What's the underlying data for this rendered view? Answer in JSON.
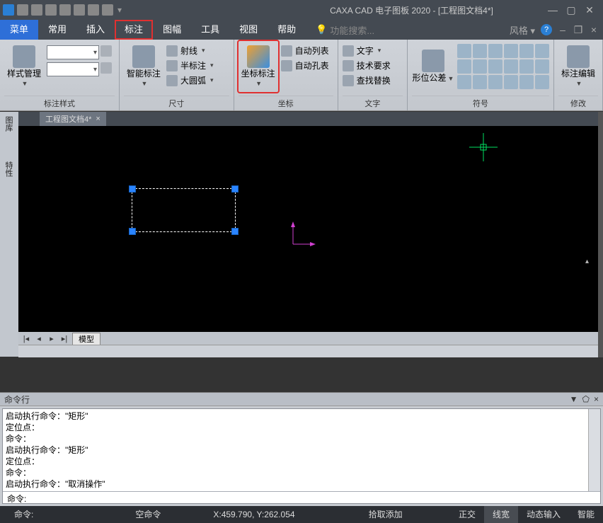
{
  "title": "CAXA CAD 电子图板 2020 - [工程图文档4*]",
  "menubar": {
    "items": [
      "菜单",
      "常用",
      "插入",
      "标注",
      "图幅",
      "工具",
      "视图",
      "帮助"
    ],
    "search_placeholder": "功能搜索...",
    "style_label": "风格"
  },
  "ribbon": {
    "g1": {
      "label": "标注样式",
      "big": "样式管理"
    },
    "g2": {
      "label": "尺寸",
      "big": "智能标注",
      "rows": [
        "射线",
        "半标注",
        "大圆弧"
      ]
    },
    "g3": {
      "label": "坐标",
      "big": "坐标标注",
      "rows": [
        "自动列表",
        "自动孔表"
      ]
    },
    "g4": {
      "label": "文字",
      "rows": [
        "文字",
        "技术要求",
        "查找替换"
      ]
    },
    "g5": {
      "label": "符号",
      "big": "形位公差"
    },
    "g6": {
      "label": "修改",
      "big": "标注编辑"
    }
  },
  "leftdock": {
    "tab1": "图库",
    "tab2": "特性"
  },
  "doc": {
    "tab": "工程图文档4*",
    "sheet": "模型"
  },
  "cmd_panel": {
    "title": "命令行",
    "lines": [
      "启动执行命令：\"矩形\"",
      "定位点：",
      "命令：",
      "启动执行命令：\"矩形\"",
      "定位点：",
      "命令：",
      "启动执行命令：\"取消操作\""
    ],
    "prompt": "命令:"
  },
  "status": {
    "cmd": "命令:",
    "empty": "空命令",
    "coord": "X:459.790, Y:262.054",
    "pick": "拾取添加",
    "ortho": "正交",
    "lw": "线宽",
    "dyn": "动态输入",
    "smart": "智能"
  }
}
